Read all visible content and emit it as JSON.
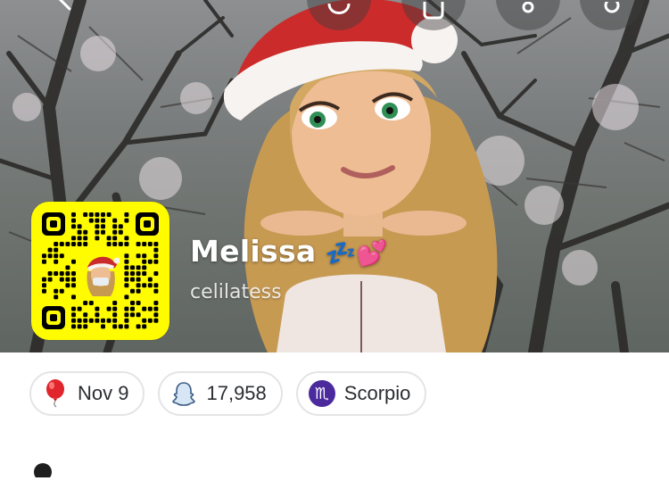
{
  "profile": {
    "display_name": "Melissa",
    "display_name_emoji": "💤💕",
    "username": "celilatess"
  },
  "top_bar": {
    "icons": [
      "back-icon",
      "friend-icon",
      "story-icon",
      "share-icon",
      "gear-icon"
    ]
  },
  "pills": [
    {
      "icon": "balloon-icon",
      "label": "Nov 9"
    },
    {
      "icon": "snapscore-ghost-icon",
      "label": "17,958"
    },
    {
      "icon": "scorpio-icon",
      "glyph": "♏",
      "label": "Scorpio"
    }
  ],
  "colors": {
    "snapcode_yellow": "#FFFC00",
    "pill_border": "#e3e4e6",
    "zodiac_purple": "#4b2a9e",
    "balloon_red": "#e0262c"
  }
}
